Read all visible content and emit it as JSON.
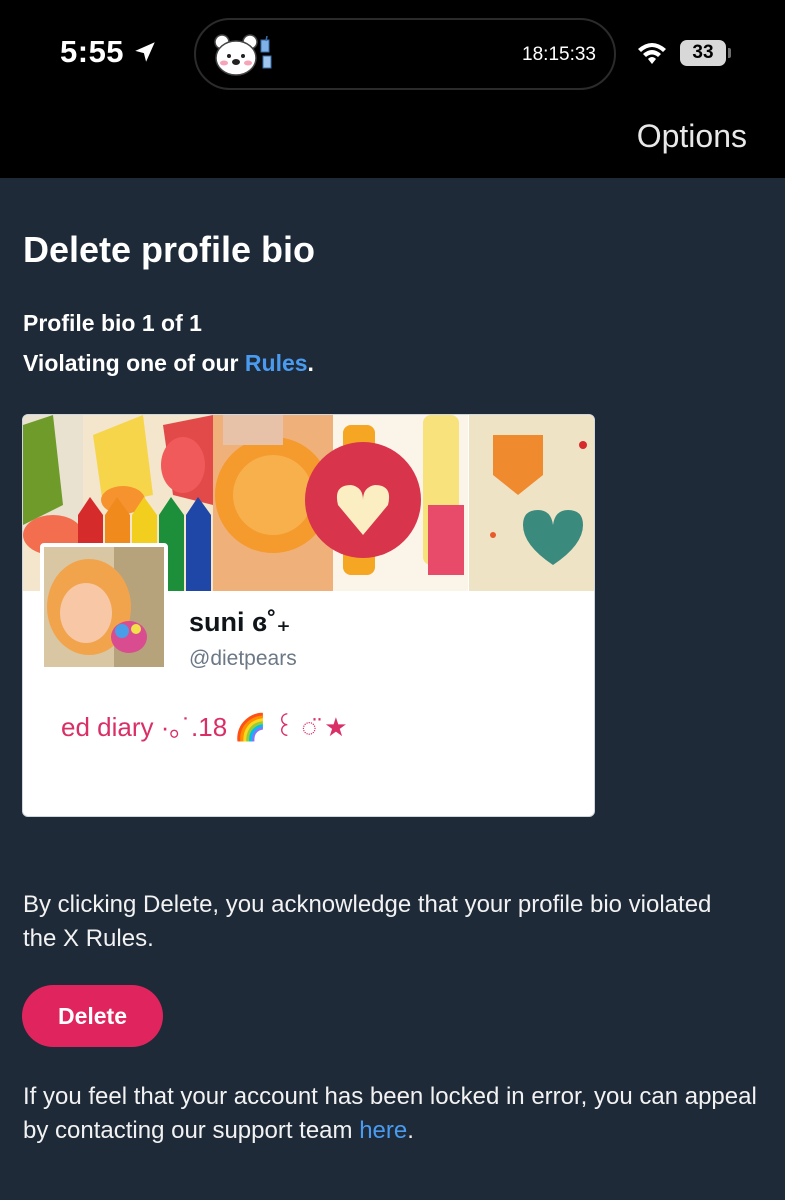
{
  "status_bar": {
    "time": "5:55",
    "island_clock": "18:15:33",
    "battery_level": "33"
  },
  "header": {
    "options_label": "Options"
  },
  "main": {
    "title": "Delete profile bio",
    "bio_count": "Profile bio 1 of 1",
    "violation_prefix": "Violating one of our ",
    "rules_link": "Rules",
    "violation_suffix": ".",
    "acknowledge_text": "By clicking Delete, you acknowledge that your profile bio violated the X Rules.",
    "delete_label": "Delete",
    "appeal_prefix": "If you feel that your account has been locked in error, you can appeal by contacting our support team ",
    "appeal_link": "here",
    "appeal_suffix": "."
  },
  "profile_card": {
    "display_name": "suni ɞ˚₊",
    "handle": "@dietpears",
    "bio": "ed diary ·｡˙.18 🌈 ꒰ ◌̈ ★"
  },
  "colors": {
    "background": "#1e2a38",
    "topbar": "#000000",
    "link": "#4a9bf0",
    "delete_button": "#e0245e",
    "bio_text": "#d92f66"
  },
  "icons": {
    "location": "location-arrow-icon",
    "wifi": "wifi-icon",
    "battery": "battery-icon",
    "bear": "bear-sticker-icon"
  }
}
